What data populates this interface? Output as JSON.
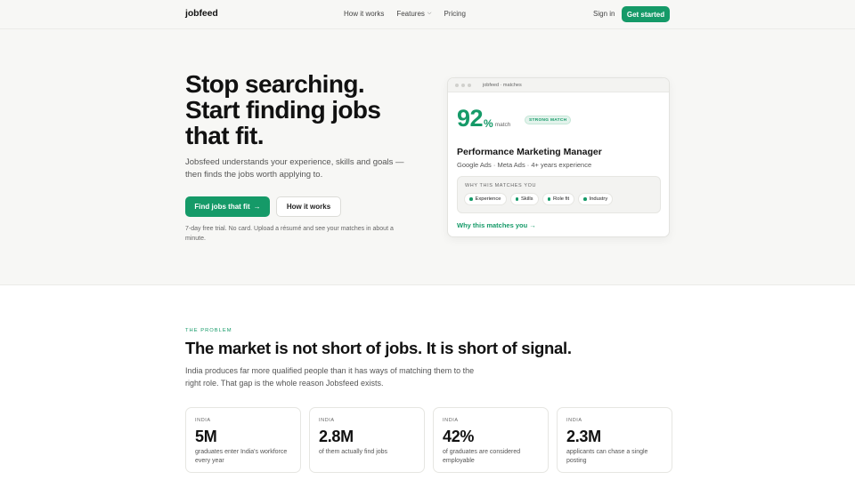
{
  "nav": {
    "brand": "jobfeed",
    "links": [
      "How it works",
      "Features",
      "Pricing"
    ],
    "signin": "Sign in",
    "cta": "Get started"
  },
  "hero": {
    "title_lines": [
      "Stop searching.",
      "Start finding jobs",
      "that fit."
    ],
    "subtitle": "Jobsfeed understands your experience, skills and goals — then finds the jobs worth applying to.",
    "primary_button": "Find jobs that fit",
    "primary_arrow": "→",
    "secondary_button": "How it works",
    "note": "7-day free trial. No card. Upload a résumé and see your matches in about a minute."
  },
  "match_card": {
    "window_title": "jobfeed · matches",
    "score": "92",
    "percent_sign": "%",
    "match_word": "match",
    "badge": "STRONG MATCH",
    "job_title": "Performance Marketing Manager",
    "job_meta": "Google Ads · Meta Ads · 4+ years experience",
    "why_label": "WHY THIS MATCHES YOU",
    "chips": [
      "Experience",
      "Skills",
      "Role fit",
      "Industry"
    ],
    "link": "Why this matches you",
    "link_arrow": "→"
  },
  "problem": {
    "eyebrow": "THE PROBLEM",
    "title": "The market is not short of jobs. It is short of signal.",
    "body": "India produces far more qualified people than it has ways of matching them to the right role. That gap is the whole reason Jobsfeed exists.",
    "stats": [
      {
        "region": "INDIA",
        "value": "5M",
        "desc": "graduates enter India's workforce every year"
      },
      {
        "region": "INDIA",
        "value": "2.8M",
        "desc": "of them actually find jobs"
      },
      {
        "region": "INDIA",
        "value": "42%",
        "desc": "of graduates are considered employable"
      },
      {
        "region": "INDIA",
        "value": "2.3M",
        "desc": "applicants can chase a single posting"
      }
    ]
  },
  "colors": {
    "accent": "#159a68",
    "hero_bg": "#f7f7f5"
  }
}
